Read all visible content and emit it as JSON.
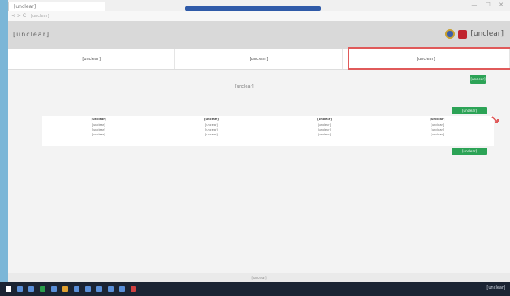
{
  "browser": {
    "tab_title": "[unclear]",
    "address": "[unclear]",
    "nav_buttons": "< > C",
    "window_controls": "— ☐ ✕"
  },
  "header": {
    "site_title": "[unclear]",
    "logo_text": "[unclear]"
  },
  "tabs": [
    {
      "label": "[unclear]"
    },
    {
      "label": "[unclear]"
    },
    {
      "label": "[unclear]"
    }
  ],
  "buttons": {
    "top_small": "[unclear]",
    "above_table": "[unclear]",
    "below_table": "[unclear]"
  },
  "caption": "[unclear]",
  "table": {
    "headers": [
      "[unclear]",
      "[unclear]",
      "[unclear]",
      "[unclear]"
    ],
    "rows": [
      [
        "[unclear]",
        "[unclear]",
        "[unclear]",
        "[unclear]"
      ],
      [
        "[unclear]",
        "[unclear]",
        "[unclear]",
        "[unclear]"
      ],
      [
        "[unclear]",
        "[unclear]",
        "[unclear]",
        "[unclear]"
      ]
    ]
  },
  "footer": "[unclear]",
  "taskbar": {
    "tray_text": "[unclear]"
  },
  "colors": {
    "accent_green": "#2ca356",
    "highlight_red": "#e05a5a",
    "header_gray": "#d9d9d9",
    "taskbar": "#1b2433"
  }
}
